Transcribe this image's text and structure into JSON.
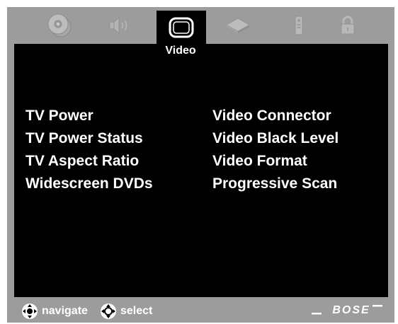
{
  "menu": {
    "title": "Video",
    "tabs": [
      {
        "icon": "disc-icon",
        "active": false
      },
      {
        "icon": "speaker-icon",
        "active": false
      },
      {
        "icon": "tv-icon",
        "active": true
      },
      {
        "icon": "cd-tray-icon",
        "active": false
      },
      {
        "icon": "remote-icon",
        "active": false
      },
      {
        "icon": "lock-icon",
        "active": false
      }
    ],
    "left_items": [
      "TV Power",
      "TV Power Status",
      "TV Aspect Ratio",
      "Widescreen DVDs"
    ],
    "right_items": [
      "Video Connector",
      "Video Black Level",
      "Video Format",
      "Progressive Scan"
    ]
  },
  "footer": {
    "navigate_label": "navigate",
    "select_label": "select",
    "brand": "BOSE"
  },
  "colors": {
    "frame": "#9c9c9c",
    "screen": "#000000",
    "text": "#ffffff",
    "inactive_icon": "#b8b8b8"
  }
}
